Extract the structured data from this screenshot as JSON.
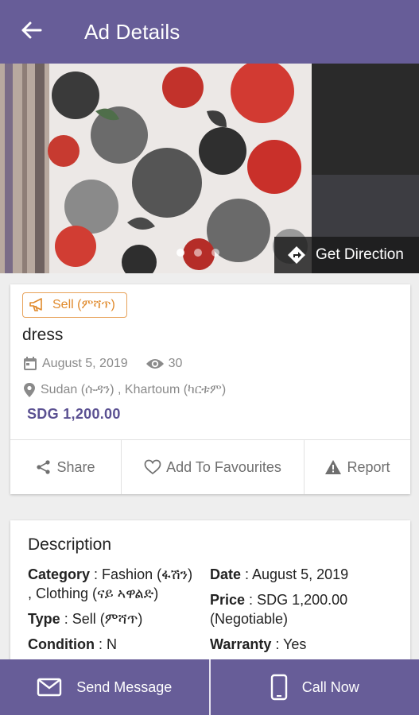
{
  "header": {
    "title": "Ad Details",
    "back_icon": "arrow-left-icon"
  },
  "hero": {
    "image_alt": "floral dress photo",
    "pager": {
      "count": 3,
      "active_index": 0
    },
    "direction_label": "Get Direction",
    "direction_icon": "directions-icon"
  },
  "ad": {
    "badge": "Sell (ምሻጥ)",
    "badge_icon": "megaphone-icon",
    "title": "dress",
    "date": "August 5, 2019",
    "views": "30",
    "location": "Sudan (ሱዳን) , Khartoum (ካርቱም)",
    "price": "SDG 1,200.00"
  },
  "actions": {
    "share": "Share",
    "favourite": "Add To Favourites",
    "report": "Report"
  },
  "description": {
    "heading": "Description",
    "category_label": "Category",
    "category_value": "Fashion (ፋሽን) , Clothing (ናይ ኣዋልድ)",
    "type_label": "Type",
    "type_value": "Sell (ምሻጥ)",
    "condition_label": "Condition",
    "condition_value": "N",
    "date_label": "Date",
    "date_value": "August 5, 2019",
    "price_label": "Price",
    "price_value": "SDG 1,200.00 (Negotiable)",
    "warranty_label": "Warranty",
    "warranty_value": "Yes"
  },
  "bottom_bar": {
    "message": "Send Message",
    "call": "Call Now"
  },
  "colors": {
    "primary": "#675d98",
    "accent_orange": "#e08a2c",
    "price": "#5b5192"
  }
}
